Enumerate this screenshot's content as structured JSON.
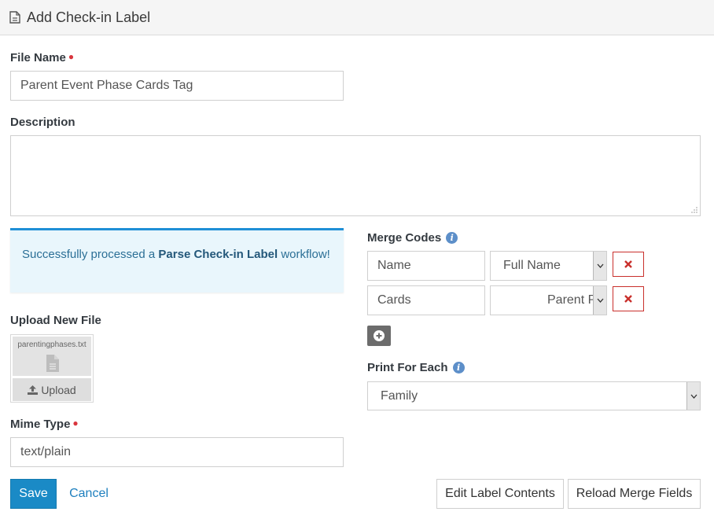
{
  "header": {
    "title": "Add Check-in Label",
    "icon": "document-icon"
  },
  "file_name": {
    "label": "File Name",
    "required": true,
    "value": "Parent Event Phase Cards Tag"
  },
  "description": {
    "label": "Description",
    "value": ""
  },
  "alert": {
    "prefix": "Successfully processed a ",
    "workflow_name": "Parse Check-in Label",
    "suffix": " workflow!"
  },
  "upload": {
    "label": "Upload New File",
    "file_name": "parentingphases.txt",
    "button_label": "Upload"
  },
  "mime_type": {
    "label": "Mime Type",
    "required": true,
    "value": "text/plain"
  },
  "merge_codes": {
    "label": "Merge Codes",
    "rows": [
      {
        "key": "Name",
        "selected": "Full Name"
      },
      {
        "key": "Cards",
        "selected": "Parent P"
      }
    ]
  },
  "print_for_each": {
    "label": "Print For Each",
    "selected": "Family"
  },
  "actions": {
    "save": "Save",
    "cancel": "Cancel",
    "edit_label_contents": "Edit Label Contents",
    "reload_merge_fields": "Reload Merge Fields"
  },
  "colors": {
    "primary": "#1a8ac6",
    "danger": "#d9363e",
    "alert_background": "#e9f6fc",
    "alert_border": "#1f8fd6"
  }
}
